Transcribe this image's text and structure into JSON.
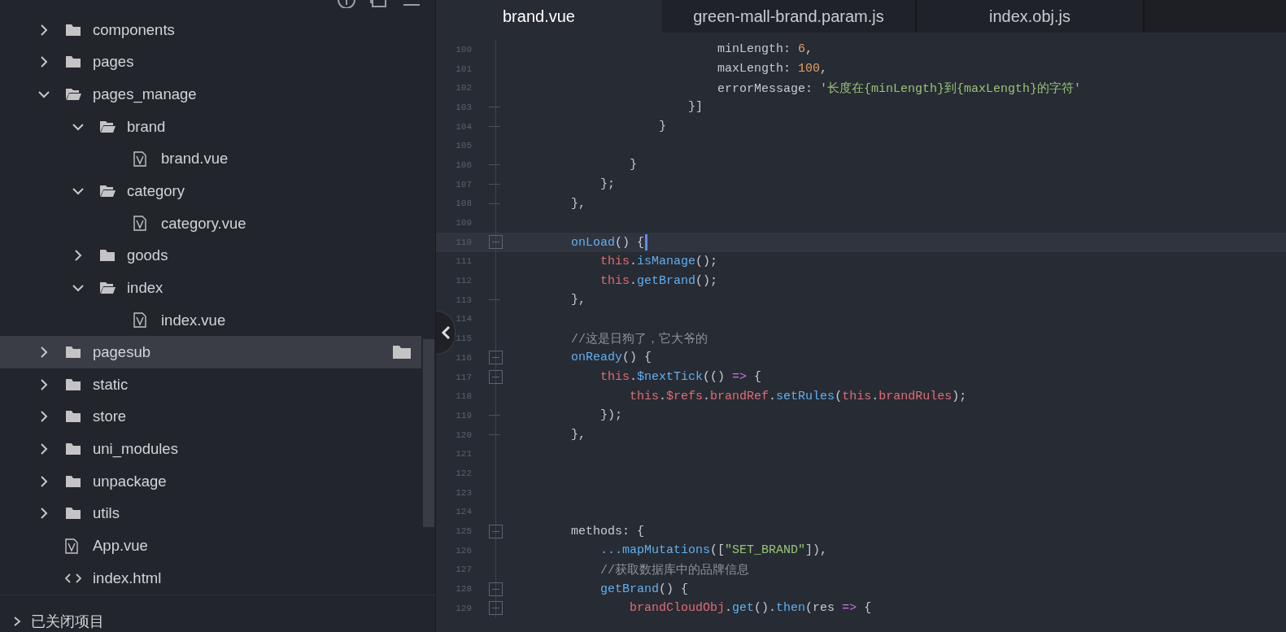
{
  "sidebar": {
    "tree": [
      {
        "name": "components",
        "kind": "folder",
        "expanded": false,
        "selected": false
      },
      {
        "name": "pages",
        "kind": "folder",
        "expanded": false,
        "selected": false
      },
      {
        "name": "pages_manage",
        "kind": "folder",
        "expanded": true,
        "selected": false,
        "children": [
          {
            "name": "brand",
            "kind": "folder",
            "expanded": true,
            "selected": false,
            "children": [
              {
                "name": "brand.vue",
                "kind": "vue",
                "selected": false
              }
            ]
          },
          {
            "name": "category",
            "kind": "folder",
            "expanded": true,
            "selected": false,
            "children": [
              {
                "name": "category.vue",
                "kind": "vue",
                "selected": false
              }
            ]
          },
          {
            "name": "goods",
            "kind": "folder",
            "expanded": false,
            "selected": false
          },
          {
            "name": "index",
            "kind": "folder",
            "expanded": true,
            "selected": false,
            "children": [
              {
                "name": "index.vue",
                "kind": "vue",
                "selected": false
              }
            ]
          }
        ]
      },
      {
        "name": "pagesub",
        "kind": "folder",
        "expanded": false,
        "selected": true
      },
      {
        "name": "static",
        "kind": "folder",
        "expanded": false,
        "selected": false
      },
      {
        "name": "store",
        "kind": "folder",
        "expanded": false,
        "selected": false
      },
      {
        "name": "uni_modules",
        "kind": "folder",
        "expanded": false,
        "selected": false
      },
      {
        "name": "unpackage",
        "kind": "folder",
        "expanded": false,
        "selected": false
      },
      {
        "name": "utils",
        "kind": "folder",
        "expanded": false,
        "selected": false
      },
      {
        "name": "App.vue",
        "kind": "vue",
        "selected": false
      },
      {
        "name": "index.html",
        "kind": "html",
        "selected": false
      }
    ],
    "closed_projects": {
      "label": "已关闭项目",
      "expanded": false
    }
  },
  "tabs": [
    {
      "label": "brand.vue",
      "selected": true
    },
    {
      "label": "green-mall-brand.param.js",
      "selected": false
    },
    {
      "label": "index.obj.js",
      "selected": false
    }
  ],
  "editor": {
    "lines": [
      {
        "number": "100",
        "kind": "plain",
        "current": false,
        "tokens": [
          {
            "text": "                            minLength",
            "kind": "prop"
          },
          {
            "text": ": ",
            "kind": "plain"
          },
          {
            "text": "6",
            "kind": "number"
          },
          {
            "text": ",",
            "kind": "plain"
          }
        ]
      },
      {
        "number": "101",
        "kind": "plain",
        "current": false,
        "tokens": [
          {
            "text": "                            maxLength",
            "kind": "prop"
          },
          {
            "text": ": ",
            "kind": "plain"
          },
          {
            "text": "100",
            "kind": "number"
          },
          {
            "text": ",",
            "kind": "plain"
          }
        ]
      },
      {
        "number": "102",
        "kind": "plain",
        "current": false,
        "tokens": [
          {
            "text": "                            errorMessage",
            "kind": "prop"
          },
          {
            "text": ": ",
            "kind": "plain"
          },
          {
            "text": "'长度在{minLength}到{maxLength}的字符'",
            "kind": "string"
          }
        ]
      },
      {
        "number": "103",
        "kind": "end",
        "current": false,
        "tokens": [
          {
            "text": "                        }]",
            "kind": "plain"
          }
        ]
      },
      {
        "number": "104",
        "kind": "end",
        "current": false,
        "tokens": [
          {
            "text": "                    }",
            "kind": "plain"
          }
        ]
      },
      {
        "number": "105",
        "kind": "plain",
        "current": false
      },
      {
        "number": "106",
        "kind": "end",
        "current": false,
        "tokens": [
          {
            "text": "                }",
            "kind": "plain"
          }
        ]
      },
      {
        "number": "107",
        "kind": "end",
        "current": false,
        "tokens": [
          {
            "text": "            };",
            "kind": "plain"
          }
        ]
      },
      {
        "number": "108",
        "kind": "end",
        "current": false,
        "tokens": [
          {
            "text": "        },",
            "kind": "plain"
          }
        ]
      },
      {
        "number": "109",
        "kind": "plain",
        "current": false
      },
      {
        "number": "110",
        "kind": "fold",
        "current": true,
        "tokens": [
          {
            "text": "        onLoad",
            "kind": "func"
          },
          {
            "text": "() {",
            "kind": "plain"
          }
        ]
      },
      {
        "number": "111",
        "kind": "plain",
        "current": false,
        "tokens": [
          {
            "text": "            this",
            "kind": "keyword"
          },
          {
            "text": ".",
            "kind": "plain"
          },
          {
            "text": "isManage",
            "kind": "func"
          },
          {
            "text": "();",
            "kind": "plain"
          }
        ]
      },
      {
        "number": "112",
        "kind": "plain",
        "current": false,
        "tokens": [
          {
            "text": "            this",
            "kind": "keyword"
          },
          {
            "text": ".",
            "kind": "plain"
          },
          {
            "text": "getBrand",
            "kind": "func"
          },
          {
            "text": "();",
            "kind": "plain"
          }
        ]
      },
      {
        "number": "113",
        "kind": "end",
        "current": false,
        "tokens": [
          {
            "text": "        },",
            "kind": "plain"
          }
        ]
      },
      {
        "number": "114",
        "kind": "plain",
        "current": false
      },
      {
        "number": "115",
        "kind": "plain",
        "current": false,
        "tokens": [
          {
            "text": "        //这是日狗了，它大爷的",
            "kind": "comment"
          }
        ]
      },
      {
        "number": "116",
        "kind": "fold",
        "current": false,
        "tokens": [
          {
            "text": "        onReady",
            "kind": "func"
          },
          {
            "text": "() {",
            "kind": "plain"
          }
        ]
      },
      {
        "number": "117",
        "kind": "fold",
        "current": false,
        "tokens": [
          {
            "text": "            this",
            "kind": "keyword"
          },
          {
            "text": ".",
            "kind": "plain"
          },
          {
            "text": "$nextTick",
            "kind": "func"
          },
          {
            "text": "(() ",
            "kind": "plain"
          },
          {
            "text": "=>",
            "kind": "operator"
          },
          {
            "text": " {",
            "kind": "plain"
          }
        ]
      },
      {
        "number": "118",
        "kind": "plain",
        "current": false,
        "tokens": [
          {
            "text": "                this",
            "kind": "keyword"
          },
          {
            "text": ".",
            "kind": "plain"
          },
          {
            "text": "$refs",
            "kind": "keyword"
          },
          {
            "text": ".",
            "kind": "plain"
          },
          {
            "text": "brandRef",
            "kind": "keyword"
          },
          {
            "text": ".",
            "kind": "plain"
          },
          {
            "text": "setRules",
            "kind": "func"
          },
          {
            "text": "(",
            "kind": "plain"
          },
          {
            "text": "this",
            "kind": "keyword"
          },
          {
            "text": ".",
            "kind": "plain"
          },
          {
            "text": "brandRules",
            "kind": "keyword"
          },
          {
            "text": ");",
            "kind": "plain"
          }
        ]
      },
      {
        "number": "119",
        "kind": "end",
        "current": false,
        "tokens": [
          {
            "text": "            });",
            "kind": "plain"
          }
        ]
      },
      {
        "number": "120",
        "kind": "end",
        "current": false,
        "tokens": [
          {
            "text": "        },",
            "kind": "plain"
          }
        ]
      },
      {
        "number": "121",
        "kind": "plain",
        "current": false
      },
      {
        "number": "122",
        "kind": "plain",
        "current": false
      },
      {
        "number": "123",
        "kind": "plain",
        "current": false
      },
      {
        "number": "124",
        "kind": "plain",
        "current": false
      },
      {
        "number": "125",
        "kind": "fold",
        "current": false,
        "tokens": [
          {
            "text": "        methods",
            "kind": "plain"
          },
          {
            "text": ": {",
            "kind": "plain"
          }
        ]
      },
      {
        "number": "126",
        "kind": "plain",
        "current": false,
        "tokens": [
          {
            "text": "            ...",
            "kind": "func"
          },
          {
            "text": "mapMutations",
            "kind": "func"
          },
          {
            "text": "([",
            "kind": "plain"
          },
          {
            "text": "\"SET_BRAND\"",
            "kind": "string"
          },
          {
            "text": "]),",
            "kind": "plain"
          }
        ]
      },
      {
        "number": "127",
        "kind": "plain",
        "current": false,
        "tokens": [
          {
            "text": "            //获取数据库中的品牌信息",
            "kind": "comment"
          }
        ]
      },
      {
        "number": "128",
        "kind": "fold",
        "current": false,
        "tokens": [
          {
            "text": "            getBrand",
            "kind": "func"
          },
          {
            "text": "() {",
            "kind": "plain"
          }
        ]
      },
      {
        "number": "129",
        "kind": "fold",
        "current": false,
        "tokens": [
          {
            "text": "                brandCloudObj",
            "kind": "keyword"
          },
          {
            "text": ".",
            "kind": "plain"
          },
          {
            "text": "get",
            "kind": "func"
          },
          {
            "text": "().",
            "kind": "plain"
          },
          {
            "text": "then",
            "kind": "func"
          },
          {
            "text": "(res ",
            "kind": "plain"
          },
          {
            "text": "=>",
            "kind": "operator"
          },
          {
            "text": " {",
            "kind": "plain"
          }
        ]
      }
    ]
  }
}
